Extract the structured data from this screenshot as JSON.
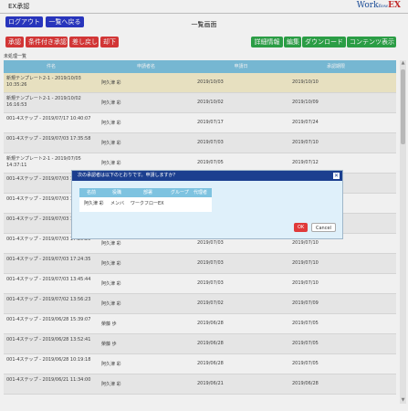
{
  "app": {
    "title": "EX承認",
    "brand_word": "Work",
    "brand_mid": "flow",
    "brand_ex": "EX"
  },
  "toolbar": {
    "logout": "ログアウト",
    "back": "一覧へ戻る",
    "approve": "承認",
    "conditional_approve": "条件付き承認",
    "send_back": "差し戻し",
    "reject": "却下",
    "details": "詳細情報",
    "edit": "編集",
    "download": "ダウンロード",
    "contents": "コンテンツ表示"
  },
  "page": {
    "title": "一覧画面",
    "list_label": "未処理一覧"
  },
  "table": {
    "headers": [
      "件名",
      "申請者名",
      "申請日",
      "承認期限"
    ],
    "rows": [
      {
        "subject": "新規テンプレート2-1 - 2019/10/03 10:35:26",
        "applicant": "阿久津 彩",
        "date": "2019/10/03",
        "deadline": "2019/10/10"
      },
      {
        "subject": "新規テンプレート2-1 - 2019/10/02 16:16:53",
        "applicant": "阿久津 彩",
        "date": "2019/10/02",
        "deadline": "2019/10/09"
      },
      {
        "subject": "001-4ステップ - 2019/07/17 10:40:07",
        "applicant": "阿久津 彩",
        "date": "2019/07/17",
        "deadline": "2019/07/24"
      },
      {
        "subject": "001-4ステップ - 2019/07/03 17:35:58",
        "applicant": "阿久津 彩",
        "date": "2019/07/03",
        "deadline": "2019/07/10"
      },
      {
        "subject": "新規テンプレート2-1 - 2019/07/05 14:37:11",
        "applicant": "阿久津 彩",
        "date": "2019/07/05",
        "deadline": "2019/07/12"
      },
      {
        "subject": "001-4ステップ - 2019/07/03 17:31:02",
        "applicant": "",
        "date": "",
        "deadline": ""
      },
      {
        "subject": "001-4ステップ - 2019/07/03 17:28:39",
        "applicant": "",
        "date": "",
        "deadline": ""
      },
      {
        "subject": "001-4ステップ - 2019/07/03 17:27:11",
        "applicant": "",
        "date": "",
        "deadline": ""
      },
      {
        "subject": "001-4ステップ - 2019/07/03 17:25:25",
        "applicant": "阿久津 彩",
        "date": "2019/07/03",
        "deadline": "2019/07/10"
      },
      {
        "subject": "001-4ステップ - 2019/07/03 17:24:35",
        "applicant": "阿久津 彩",
        "date": "2019/07/03",
        "deadline": "2019/07/10"
      },
      {
        "subject": "001-4ステップ - 2019/07/03 13:45:44",
        "applicant": "阿久津 彩",
        "date": "2019/07/03",
        "deadline": "2019/07/10"
      },
      {
        "subject": "001-4ステップ - 2019/07/02 13:56:23",
        "applicant": "阿久津 彩",
        "date": "2019/07/02",
        "deadline": "2019/07/09"
      },
      {
        "subject": "001-4ステップ - 2019/06/28 15:39:07",
        "applicant": "榮藤 歩",
        "date": "2019/06/28",
        "deadline": "2019/07/05"
      },
      {
        "subject": "001-4ステップ - 2019/06/28 13:52:41",
        "applicant": "榮藤 歩",
        "date": "2019/06/28",
        "deadline": "2019/07/05"
      },
      {
        "subject": "001-4ステップ - 2019/06/28 10:19:18",
        "applicant": "阿久津 彩",
        "date": "2019/06/28",
        "deadline": "2019/07/05"
      },
      {
        "subject": "001-4ステップ - 2019/06/21 11:34:00",
        "applicant": "阿久津 彩",
        "date": "2019/06/21",
        "deadline": "2019/06/28"
      }
    ]
  },
  "dialog": {
    "message": "次の承認者は以下のとおりです。申請しますか？",
    "headers": [
      "名前",
      "役職",
      "部署",
      "グループ",
      "代理者"
    ],
    "rows": [
      {
        "name": "阿久津 彩",
        "role": "メンバ",
        "dept": "ワークフローEX",
        "group": "",
        "proxy": ""
      }
    ],
    "ok": "OK",
    "cancel": "Cancel"
  },
  "colors": {
    "accent_blue": "#2b39c8",
    "danger_red": "#e03a3a",
    "success_green": "#2ea74a",
    "table_header": "#7ec3e0",
    "dialog_header": "#1c3f8f"
  }
}
